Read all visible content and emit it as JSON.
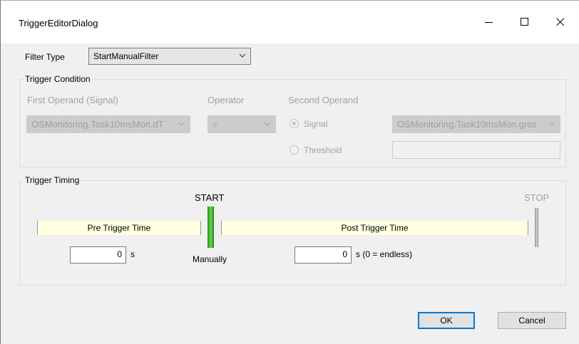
{
  "window": {
    "title": "TriggerEditorDialog",
    "controls": [
      "minimize-icon",
      "maximize-icon",
      "close-icon"
    ]
  },
  "filter": {
    "label": "Filter Type",
    "value": "StartManualFilter"
  },
  "trigger_condition": {
    "title": "Trigger Condition",
    "first_operand_label": "First Operand (Signal)",
    "first_operand_value": "OSMonitoring.Task10msMon.dT",
    "operator_label": "Operator",
    "operator_value": "=",
    "second_operand_label": "Second Operand",
    "signal_label": "Signal",
    "threshold_label": "Threshold",
    "signal_selected": true,
    "second_signal_value": "OSMonitoring.Task10msMon.gros",
    "threshold_value": ""
  },
  "trigger_timing": {
    "title": "Trigger Timing",
    "start_label": "START",
    "stop_label": "STOP",
    "pre_trigger_label": "Pre Trigger Time",
    "post_trigger_label": "Post Trigger Time",
    "pre_value": "0",
    "pre_unit": "s",
    "start_mode": "Manually",
    "post_value": "0",
    "post_unit": "s (0 = endless)"
  },
  "buttons": {
    "ok": "OK",
    "cancel": "Cancel"
  },
  "colors": {
    "start_bar": "#4caf28",
    "stop_bar": "#a8a8a8",
    "timebar_bg": "#ffffe1",
    "default_button_border": "#0078d7"
  }
}
